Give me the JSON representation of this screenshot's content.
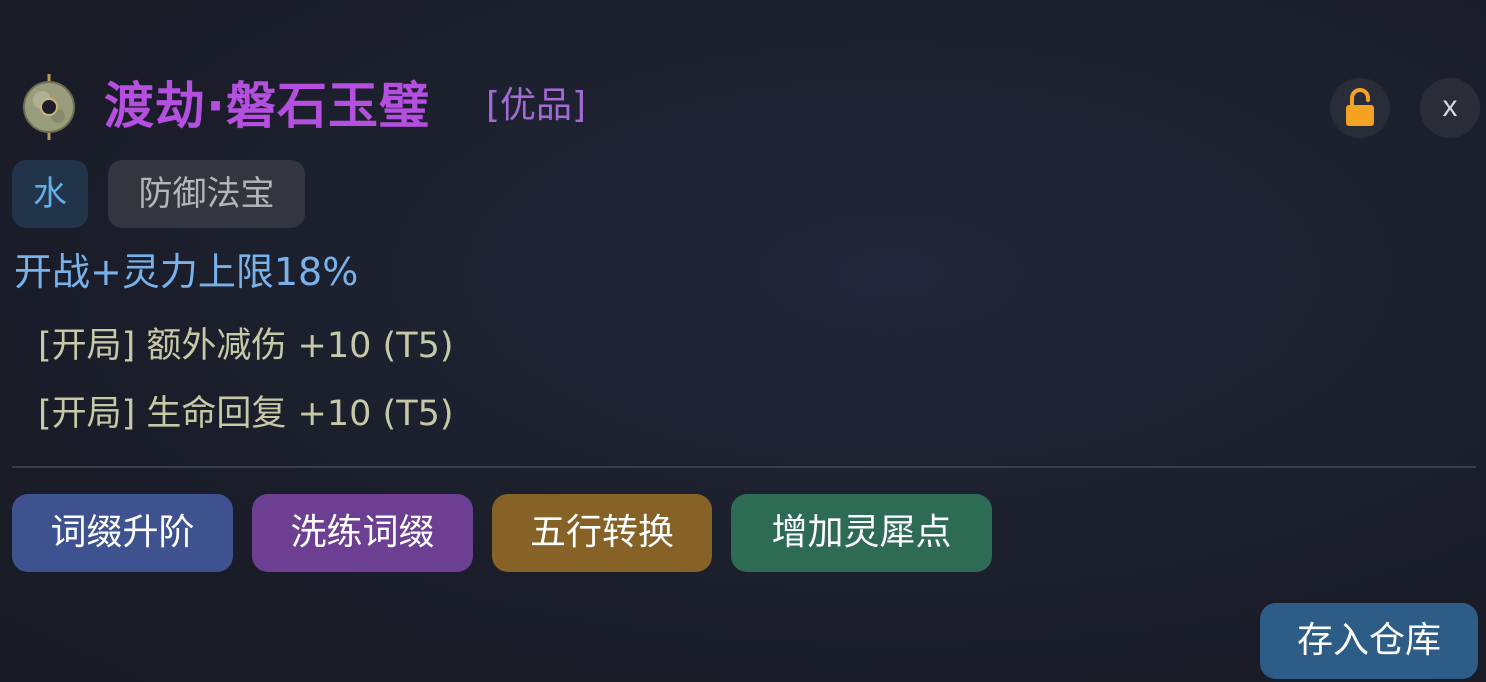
{
  "item": {
    "icon": "jade-bi-disc-icon",
    "name": "渡劫·磐石玉璧",
    "quality": "[优品]",
    "name_color": "#b44fe0",
    "quality_color": "#a26bd4"
  },
  "header_controls": {
    "lock_icon": "unlocked-padlock-icon",
    "close_label": "x"
  },
  "tags": {
    "element": "水",
    "type": "防御法宝"
  },
  "stats": {
    "main_effect": "开战+灵力上限18%",
    "affixes": [
      "[开局] 额外减伤 +10 (T5)",
      "[开局] 生命回复 +10 (T5)"
    ]
  },
  "actions": {
    "upgrade_affix": "词缀升阶",
    "reroll_affix": "洗练词缀",
    "element_convert": "五行转换",
    "add_spirit_point": "增加灵犀点"
  },
  "store": {
    "label": "存入仓库"
  },
  "colors": {
    "background": "#1c1f2b",
    "main_effect": "#79b2ea",
    "affix_text": "#c7c9a6",
    "btn_upgrade": "#3e5290",
    "btn_reroll": "#6c3f92",
    "btn_element": "#866226",
    "btn_spirit": "#2e6b55",
    "btn_store": "#2d5c86",
    "lock": "#f3a321"
  }
}
